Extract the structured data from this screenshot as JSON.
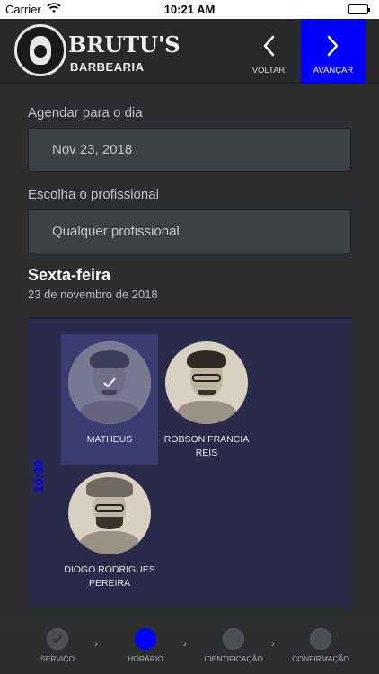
{
  "status_bar": {
    "carrier": "Carrier",
    "time": "10:21 AM"
  },
  "header": {
    "brand": "BRUTU'S",
    "sub": "BARBEARIA",
    "back_label": "VOLTAR",
    "next_label": "AVANÇAR",
    "accent_color": "#0000ff"
  },
  "form": {
    "date_label": "Agendar para o dia",
    "date_value": "Nov 23, 2018",
    "pro_label": "Escolha o profissional",
    "pro_value": "Qualquer profissional"
  },
  "day": {
    "weekday": "Sexta-feira",
    "date_text": "23 de novembro de 2018"
  },
  "schedule": {
    "time": "10:30",
    "professionals": [
      {
        "name": "MATHEUS",
        "selected": true
      },
      {
        "name": "ROBSON FRANCIA REIS",
        "selected": false
      },
      {
        "name": "DIOGO RODRIGUES PEREIRA",
        "selected": false
      }
    ]
  },
  "steps": [
    {
      "label": "SERVIÇO",
      "state": "done"
    },
    {
      "label": "HORÁRIO",
      "state": "active"
    },
    {
      "label": "IDENTIFICAÇÃO",
      "state": "pending"
    },
    {
      "label": "CONFIRMAÇÃO",
      "state": "pending"
    }
  ]
}
